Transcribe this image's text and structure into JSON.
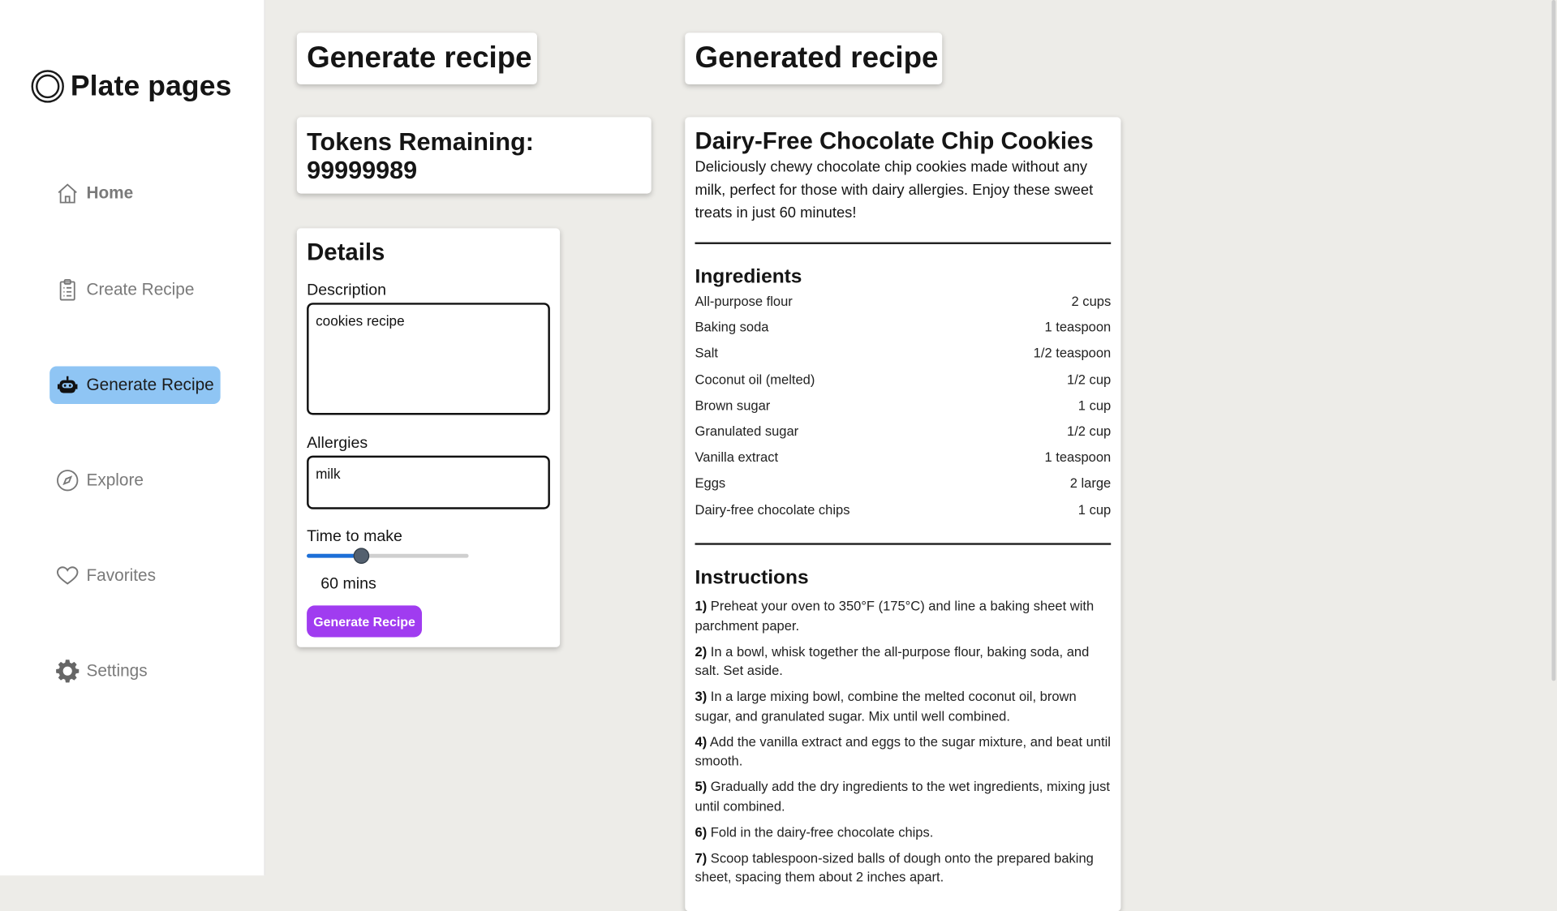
{
  "brand": {
    "name": "Plate pages",
    "icon": "ring-logo-icon"
  },
  "sidebar": {
    "items": [
      {
        "label": "Home",
        "icon": "home-icon"
      },
      {
        "label": "Create Recipe",
        "icon": "clipboard-icon"
      },
      {
        "label": "Generate Recipe",
        "icon": "robot-icon",
        "active": true
      },
      {
        "label": "Explore",
        "icon": "compass-icon"
      },
      {
        "label": "Favorites",
        "icon": "heart-icon"
      },
      {
        "label": "Settings",
        "icon": "gear-icon"
      }
    ]
  },
  "generate": {
    "heading": "Generate recipe",
    "tokens_label": "Tokens Remaining:",
    "tokens_value": "99999989",
    "details_heading": "Details",
    "description_label": "Description",
    "description_value": "cookies recipe",
    "allergies_label": "Allergies",
    "allergies_value": "milk",
    "time_label": "Time to make",
    "time_value": "60 mins",
    "time_slider_fraction": 0.33,
    "button_label": "Generate Recipe"
  },
  "generated": {
    "heading": "Generated recipe",
    "title": "Dairy-Free Chocolate Chip Cookies",
    "description": "Deliciously chewy chocolate chip cookies made without any milk, perfect for those with dairy allergies. Enjoy these sweet treats in just 60 minutes!",
    "ingredients_heading": "Ingredients",
    "ingredients": [
      {
        "name": "All-purpose flour",
        "amount": "2 cups"
      },
      {
        "name": "Baking soda",
        "amount": "1 teaspoon"
      },
      {
        "name": "Salt",
        "amount": "1/2 teaspoon"
      },
      {
        "name": "Coconut oil (melted)",
        "amount": "1/2 cup"
      },
      {
        "name": "Brown sugar",
        "amount": "1 cup"
      },
      {
        "name": "Granulated sugar",
        "amount": "1/2 cup"
      },
      {
        "name": "Vanilla extract",
        "amount": "1 teaspoon"
      },
      {
        "name": "Eggs",
        "amount": "2 large"
      },
      {
        "name": "Dairy-free chocolate chips",
        "amount": "1 cup"
      }
    ],
    "instructions_heading": "Instructions",
    "instructions": [
      {
        "num": "1)",
        "text": "Preheat your oven to 350°F (175°C) and line a baking sheet with parchment paper."
      },
      {
        "num": "2)",
        "text": "In a bowl, whisk together the all-purpose flour, baking soda, and salt. Set aside."
      },
      {
        "num": "3)",
        "text": "In a large mixing bowl, combine the melted coconut oil, brown sugar, and granulated sugar. Mix until well combined."
      },
      {
        "num": "4)",
        "text": "Add the vanilla extract and eggs to the sugar mixture, and beat until smooth."
      },
      {
        "num": "5)",
        "text": "Gradually add the dry ingredients to the wet ingredients, mixing just until combined."
      },
      {
        "num": "6)",
        "text": "Fold in the dairy-free chocolate chips."
      },
      {
        "num": "7)",
        "text": "Scoop tablespoon-sized balls of dough onto the prepared baking sheet, spacing them about 2 inches apart."
      }
    ]
  },
  "colors": {
    "background": "#edece8",
    "active_nav": "#8fc5f4",
    "button": "#a03cf0",
    "slider_fill": "#1c6fd8"
  }
}
